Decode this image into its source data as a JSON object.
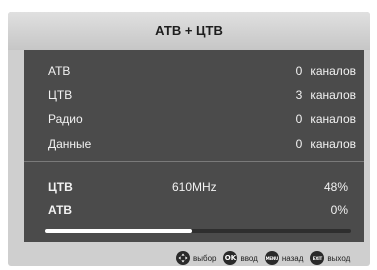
{
  "window": {
    "title": "АТВ + ЦТВ"
  },
  "channels": [
    {
      "label": "АТВ",
      "count": "0",
      "unit": "каналов"
    },
    {
      "label": "ЦТВ",
      "count": "3",
      "unit": "каналов"
    },
    {
      "label": "Радио",
      "count": "0",
      "unit": "каналов"
    },
    {
      "label": "Данные",
      "count": "0",
      "unit": "каналов"
    }
  ],
  "scan": [
    {
      "label": "ЦТВ",
      "frequency": "610MHz",
      "percent": "48%"
    },
    {
      "label": "АТВ",
      "frequency": "",
      "percent": "0%"
    }
  ],
  "progress": {
    "value": 0.48
  },
  "hints": [
    {
      "icon": "dpad-icon",
      "key": "",
      "label": "выбор"
    },
    {
      "icon": "ok-button-icon",
      "key": "OK",
      "label": "ввод"
    },
    {
      "icon": "menu-button-icon",
      "key": "MENU",
      "label": "назад"
    },
    {
      "icon": "exit-button-icon",
      "key": "EXIT",
      "label": "выход"
    }
  ],
  "colors": {
    "panel": "#4b4b4b",
    "frame": "#cfcfcf",
    "text": "#f2f2f2",
    "progress_fill": "#ffffff"
  }
}
